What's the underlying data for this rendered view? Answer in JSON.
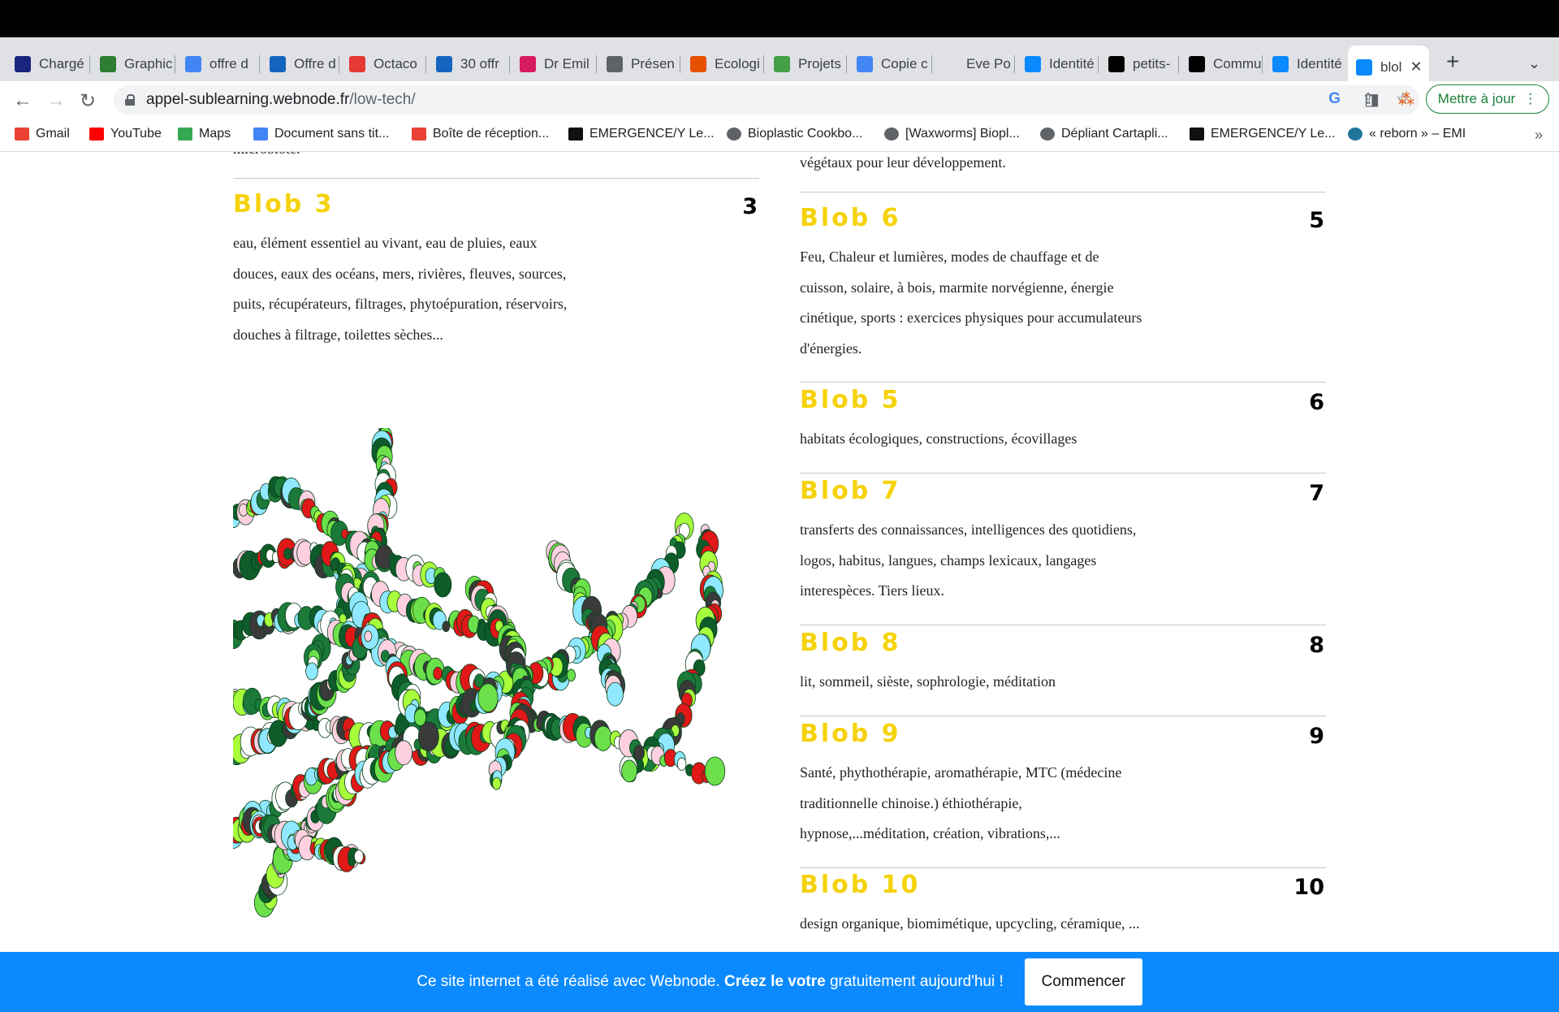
{
  "browser": {
    "tabs": [
      {
        "label": "Chargé",
        "icon": "i-icon",
        "color": "#1a237e"
      },
      {
        "label": "Graphic",
        "icon": "gj-icon",
        "color": "#2e7d32"
      },
      {
        "label": "offre d",
        "icon": "google-icon",
        "color": "#4285f4"
      },
      {
        "label": "Offre d",
        "icon": "edge-icon",
        "color": "#1565c0"
      },
      {
        "label": "Octaco",
        "icon": "octaco-icon",
        "color": "#e53935"
      },
      {
        "label": "30 offr",
        "icon": "edge-icon",
        "color": "#1565c0"
      },
      {
        "label": "Dr Emil",
        "icon": "dr-icon",
        "color": "#d81b60"
      },
      {
        "label": "Présen",
        "icon": "globe-icon",
        "color": "#5f6368"
      },
      {
        "label": "Ecologi",
        "icon": "shield-icon",
        "color": "#e65100"
      },
      {
        "label": "Projets",
        "icon": "leaf-icon",
        "color": "#43a047"
      },
      {
        "label": "Copie c",
        "icon": "docs-icon",
        "color": "#4285f4"
      },
      {
        "label": "Eve Po",
        "icon": "blank-icon",
        "color": "#dfe1e5"
      },
      {
        "label": "Identité",
        "icon": "webnode-icon",
        "color": "#0b8aff"
      },
      {
        "label": "petits-",
        "icon": "wix-icon",
        "color": "#000000"
      },
      {
        "label": "Commu",
        "icon": "wix-icon",
        "color": "#000000"
      },
      {
        "label": "Identité",
        "icon": "webnode-icon",
        "color": "#0b8aff"
      },
      {
        "label": "blol",
        "icon": "webnode-icon",
        "color": "#0b8aff"
      }
    ],
    "url_domain": "appel-sublearning.webnode.fr",
    "url_path": "/low-tech/",
    "update_label": "Mettre à jour",
    "bookmarks": [
      {
        "label": "Gmail",
        "icon": "gmail-icon",
        "color": "#ea4335"
      },
      {
        "label": "YouTube",
        "icon": "youtube-icon",
        "color": "#ff0000"
      },
      {
        "label": "Maps",
        "icon": "maps-icon",
        "color": "#34a853"
      },
      {
        "label": "Document sans tit...",
        "icon": "docs-icon",
        "color": "#4285f4"
      },
      {
        "label": "Boîte de réception...",
        "icon": "gmail-icon",
        "color": "#ea4335"
      },
      {
        "label": "EMERGENCE/Y Le...",
        "icon": "emergence-icon",
        "color": "#111111"
      },
      {
        "label": "Bioplastic Cookbo...",
        "icon": "globe-icon",
        "color": "#5f6368"
      },
      {
        "label": "[Waxworms] Biopl...",
        "icon": "globe-icon",
        "color": "#5f6368"
      },
      {
        "label": "Dépliant Cartapli...",
        "icon": "globe-icon",
        "color": "#5f6368"
      },
      {
        "label": "EMERGENCE/Y Le...",
        "icon": "emergence-icon",
        "color": "#111111"
      },
      {
        "label": "« reborn » – EMI",
        "icon": "wordpress-icon",
        "color": "#21759b"
      }
    ]
  },
  "page": {
    "top_left_fragment": "microbiote.",
    "top_right_fragment": "végétaux pour leur développement.",
    "blobs": [
      {
        "title": "Blob 3",
        "num": "3",
        "lines": [
          "eau, élément essentiel au vivant, eau de pluies, eaux",
          "douces, eaux des océans, mers, rivières, fleuves, sources,",
          "puits, récupérateurs, filtrages, phytoépuration, réservoirs,",
          "douches à filtrage, toilettes sèches..."
        ]
      },
      {
        "title": "Blob 6",
        "num": "5",
        "lines": [
          "Feu, Chaleur et lumières, modes de chauffage et de",
          "cuisson, solaire, à bois, marmite norvégienne, énergie",
          "cinétique, sports : exercices physiques pour accumulateurs",
          "d'énergies."
        ]
      },
      {
        "title": "Blob 5",
        "num": "6",
        "lines": [
          "habitats écologiques, constructions, écovillages"
        ]
      },
      {
        "title": "Blob 7",
        "num": "7",
        "lines": [
          "transferts des connaissances, intelligences des quotidiens,",
          "logos, habitus, langues, champs lexicaux, langages",
          "interespèces. Tiers lieux."
        ]
      },
      {
        "title": "Blob 8",
        "num": "8",
        "lines": [
          "lit, sommeil, sièste, sophrologie, méditation"
        ]
      },
      {
        "title": "Blob 9",
        "num": "9",
        "lines": [
          "Santé, phythothérapie, aromathérapie, MTC (médecine",
          "traditionnelle chinoise.) éthiothérapie,",
          "hypnose,...méditation, création, vibrations,..."
        ]
      },
      {
        "title": "Blob 10",
        "num": "10",
        "lines": [
          "design organique, biomimétique, upcycling, céramique, ..."
        ]
      }
    ]
  },
  "footer": {
    "text_before": "Ce site internet a été réalisé avec Webnode.",
    "text_bold": "Créez le votre",
    "text_after": "gratuitement aujourd'hui !",
    "cta_label": "Commencer",
    "background": "#0b8aff"
  },
  "colors": {
    "blob_title": "#f5d20a",
    "art_palette": [
      "#1b7a3a",
      "#0d5c2a",
      "#6ce04a",
      "#a8ff3c",
      "#e01818",
      "#ffffff",
      "#ffd0e0",
      "#3a3a3a",
      "#8fe8ff"
    ]
  }
}
